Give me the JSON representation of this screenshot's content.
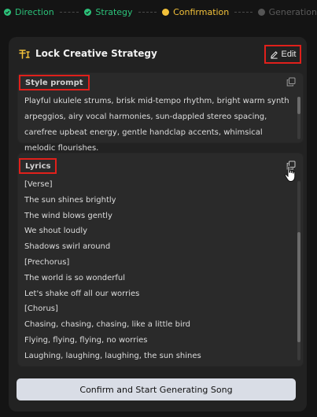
{
  "stepper": {
    "steps": [
      {
        "label": "Direction",
        "state": "done"
      },
      {
        "label": "Strategy",
        "state": "done"
      },
      {
        "label": "Confirmation",
        "state": "active"
      },
      {
        "label": "Generation",
        "state": "pending"
      }
    ]
  },
  "card": {
    "title": "Lock Creative Strategy",
    "edit_label": "Edit"
  },
  "style_prompt": {
    "label": "Style prompt",
    "text": "Playful ukulele strums, brisk mid-tempo rhythm, bright warm synth arpeggios, airy vocal harmonies, sun-dappled stereo spacing, carefree upbeat energy, gentle handclap accents, whimsical melodic flourishes."
  },
  "lyrics": {
    "label": "Lyrics",
    "lines": [
      "[Verse]",
      "The sun shines brightly",
      "The wind blows gently",
      "We shout loudly",
      "Shadows swirl around",
      "[Prechorus]",
      "The world is so wonderful",
      "Let's shake off all our worries",
      "[Chorus]",
      "Chasing, chasing, chasing, like a little bird",
      "Flying, flying, flying, no worries",
      "Laughing, laughing, laughing, the sun shines"
    ]
  },
  "confirm_label": "Confirm and Start Generating Song",
  "colors": {
    "done": "#2cc27a",
    "active": "#f2c13a",
    "highlight": "#e0201b"
  }
}
